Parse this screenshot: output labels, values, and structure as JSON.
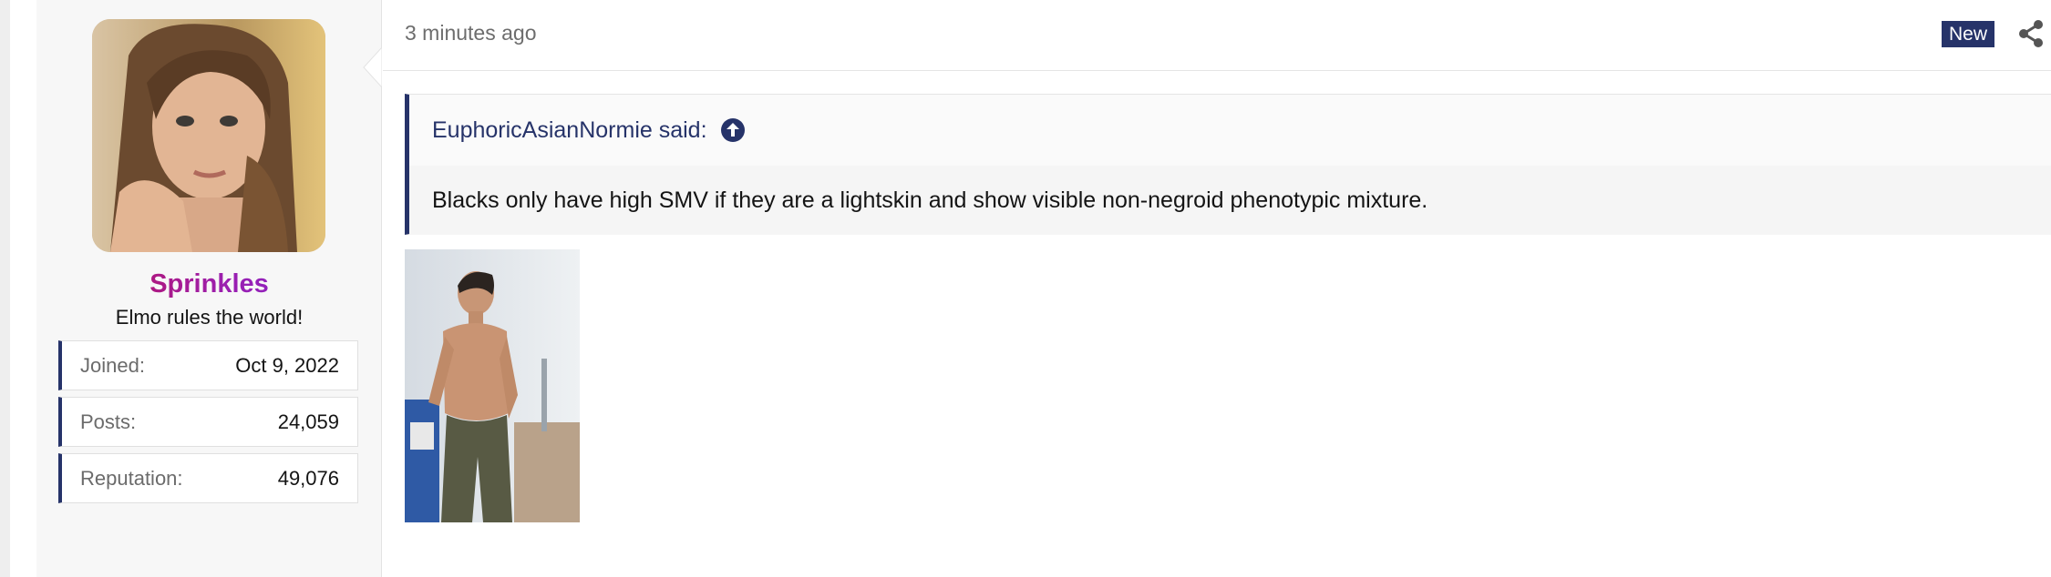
{
  "user": {
    "username": "Sprinkles",
    "title": "Elmo rules the world!",
    "stats": [
      {
        "label": "Joined:",
        "value": "Oct 9, 2022"
      },
      {
        "label": "Posts:",
        "value": "24,059"
      },
      {
        "label": "Reputation:",
        "value": "49,076"
      }
    ]
  },
  "post": {
    "timestamp": "3 minutes ago",
    "badge": "New",
    "share_icon": "share-icon",
    "quote": {
      "author_line": "EuphoricAsianNormie said:",
      "jump_icon": "arrow-up-circle-icon",
      "text": "Blacks only have high SMV if they are a lightskin and show visible non-negroid phenotypic mixture."
    }
  },
  "colors": {
    "accent": "#263369",
    "username_gradient_start": "#c8103e",
    "username_gradient_end": "#7b22d6"
  }
}
